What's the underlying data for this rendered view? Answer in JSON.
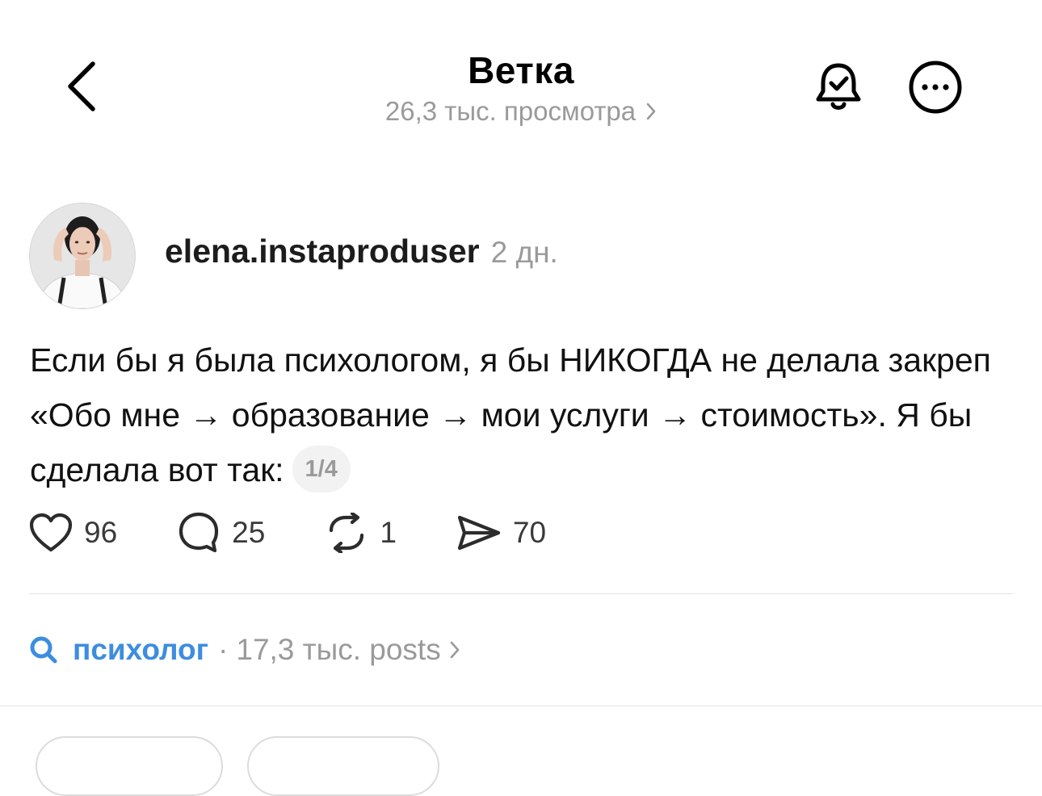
{
  "header": {
    "title": "Ветка",
    "views": "26,3 тыс. просмотра",
    "icons": {
      "back": "chevron-left-icon",
      "bell": "bell-check-icon",
      "more": "more-circle-icon",
      "views_chevron": "chevron-right-icon"
    }
  },
  "post": {
    "author": "elena.instaproduser",
    "time": "2 дн.",
    "text": "Если бы я была психологом, я бы НИКОГДА не делала закреп «Обо мне → образование → мои услуги → стоимость». Я бы сделала вот так:",
    "page_indicator": "1/4",
    "actions": {
      "likes": "96",
      "replies": "25",
      "reposts": "1",
      "shares": "70"
    }
  },
  "topic": {
    "name": "психолог",
    "separator": "·",
    "count": "17,3 тыс. posts"
  },
  "colors": {
    "accent": "#3d8ddf",
    "muted": "#9a9a9a",
    "text": "#111111",
    "divider": "#e2e2e2"
  }
}
